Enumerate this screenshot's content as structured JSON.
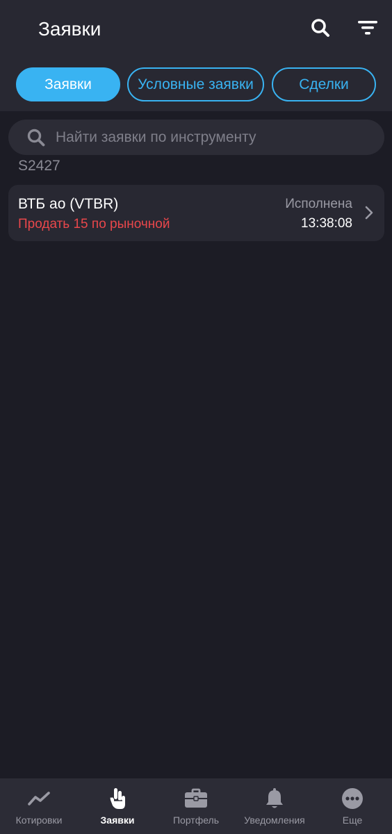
{
  "header": {
    "title": "Заявки",
    "search_icon": "search-icon",
    "filter_icon": "filter-icon"
  },
  "tabs": [
    {
      "label": "Заявки",
      "active": true
    },
    {
      "label": "Условные заявки",
      "active": false
    },
    {
      "label": "Сделки",
      "active": false
    }
  ],
  "search": {
    "placeholder": "Найти заявки по инструменту",
    "value": ""
  },
  "account": "S2427",
  "orders": [
    {
      "instrument": "ВТБ ао (VTBR)",
      "action": "Продать 15 по рыночной",
      "status": "Исполнена",
      "time": "13:38:08"
    }
  ],
  "bottom_nav": [
    {
      "label": "Котировки",
      "icon": "chart-line-icon",
      "active": false
    },
    {
      "label": "Заявки",
      "icon": "hand-icon",
      "active": true
    },
    {
      "label": "Портфель",
      "icon": "briefcase-icon",
      "active": false
    },
    {
      "label": "Уведомления",
      "icon": "bell-icon",
      "active": false
    },
    {
      "label": "Еще",
      "icon": "more-dots-icon",
      "active": false
    }
  ],
  "colors": {
    "accent": "#39b3f2",
    "sell": "#e9474b",
    "background": "#1c1c25",
    "card": "#282832"
  }
}
